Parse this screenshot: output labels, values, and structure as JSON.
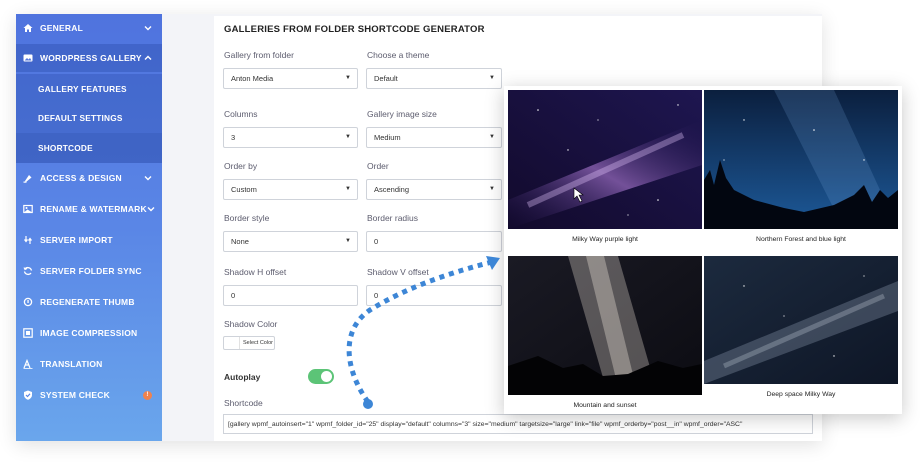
{
  "sidebar": {
    "items": [
      {
        "label": "GENERAL",
        "icon": "home-icon",
        "chevron": "chevron-down-icon"
      },
      {
        "label": "WORDPRESS GALLERY",
        "icon": "image-icon",
        "chevron": "chevron-up-icon"
      },
      {
        "label": "GALLERY FEATURES"
      },
      {
        "label": "DEFAULT SETTINGS"
      },
      {
        "label": "SHORTCODE"
      },
      {
        "label": "ACCESS & DESIGN",
        "icon": "paint-icon",
        "chevron": "chevron-down-icon"
      },
      {
        "label": "RENAME & WATERMARK",
        "icon": "picture-icon",
        "chevron": "chevron-down-icon"
      },
      {
        "label": "SERVER IMPORT",
        "icon": "import-icon"
      },
      {
        "label": "SERVER FOLDER SYNC",
        "icon": "sync-icon"
      },
      {
        "label": "REGENERATE THUMB",
        "icon": "refresh-icon"
      },
      {
        "label": "IMAGE COMPRESSION",
        "icon": "compress-icon"
      },
      {
        "label": "TRANSLATION",
        "icon": "translate-icon"
      },
      {
        "label": "SYSTEM CHECK",
        "icon": "shield-check-icon",
        "badge": "!"
      }
    ]
  },
  "panel": {
    "title": "GALLERIES FROM FOLDER SHORTCODE GENERATOR",
    "gallery_folder": {
      "label": "Gallery from folder",
      "value": "Anton Media"
    },
    "theme": {
      "label": "Choose a theme",
      "value": "Default"
    },
    "columns": {
      "label": "Columns",
      "value": "3"
    },
    "image_size": {
      "label": "Gallery image size",
      "value": "Medium"
    },
    "order_by": {
      "label": "Order by",
      "value": "Custom"
    },
    "order": {
      "label": "Order",
      "value": "Ascending"
    },
    "border_style": {
      "label": "Border style",
      "value": "None"
    },
    "border_radius": {
      "label": "Border radius",
      "value": "0"
    },
    "shadow_h": {
      "label": "Shadow H offset",
      "value": "0"
    },
    "shadow_v": {
      "label": "Shadow V offset",
      "value": "0"
    },
    "shadow_color": {
      "label": "Shadow Color",
      "button": "Select Color"
    },
    "autoplay": {
      "label": "Autoplay",
      "on": true
    },
    "shortcode": {
      "label": "Shortcode",
      "value": "[gallery wpmf_autoinsert=\"1\" wpmf_folder_id=\"25\" display=\"default\" columns=\"3\" size=\"medium\" targetsize=\"large\" link=\"file\" wpmf_orderby=\"post__in\" wpmf_order=\"ASC\""
    }
  },
  "gallery": {
    "captions": [
      "Milky Way purple light",
      "Northern Forest and blue light",
      "Mountain and sunset",
      "Deep space Milky Way"
    ]
  },
  "colors": {
    "accent": "#4f73de",
    "toggle_on": "#5cc477",
    "badge": "#f0824d",
    "arrow": "#3d86d6"
  }
}
